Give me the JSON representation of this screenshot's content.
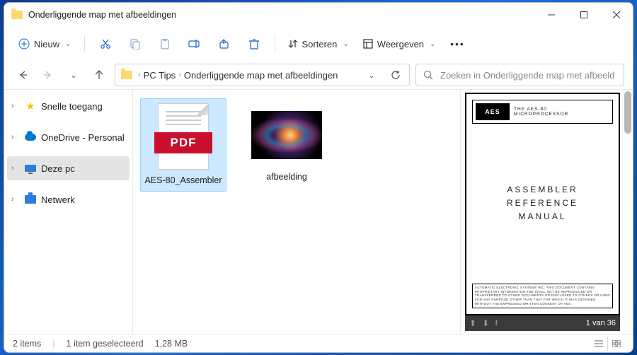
{
  "window": {
    "title": "Onderliggende map met afbeeldingen"
  },
  "toolbar": {
    "new_label": "Nieuw",
    "sort_label": "Sorteren",
    "view_label": "Weergeven"
  },
  "breadcrumb": {
    "seg1": "PC Tips",
    "seg2": "Onderliggende map met afbeeldingen"
  },
  "search": {
    "placeholder": "Zoeken in Onderliggende map met afbeeldingen"
  },
  "sidebar": {
    "quick": "Snelle toegang",
    "onedrive": "OneDrive - Personal",
    "thispc": "Deze pc",
    "network": "Netwerk"
  },
  "files": {
    "items": [
      {
        "name": "AES-80_Assembler",
        "badge": "PDF"
      },
      {
        "name": "afbeelding"
      }
    ]
  },
  "preview": {
    "logo": "AES",
    "sub1": "THE AES-80",
    "sub2": "MICROPROCESSOR",
    "title1": "ASSEMBLER",
    "title2": "REFERENCE",
    "title3": "MANUAL",
    "page_indicator": "1 van 36"
  },
  "status": {
    "items": "2 items",
    "selected": "1 item geselecteerd",
    "size": "1,28 MB"
  }
}
